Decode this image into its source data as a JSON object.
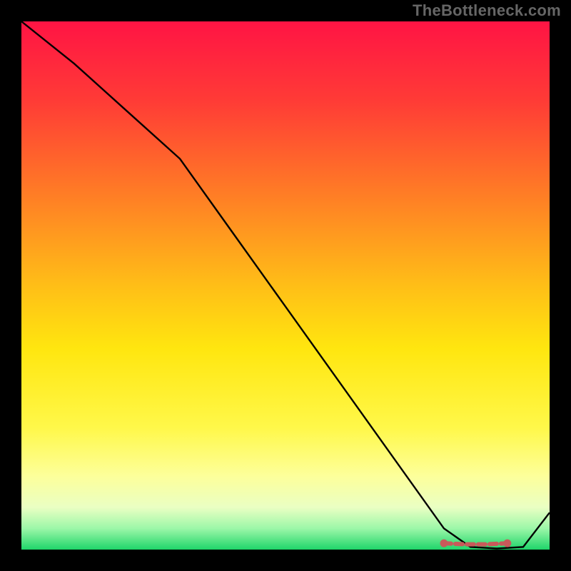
{
  "watermark": "TheBottleneck.com",
  "chart_data": {
    "type": "line",
    "title": "",
    "xlabel": "",
    "ylabel": "",
    "xlim": [
      0,
      100
    ],
    "ylim": [
      0,
      100
    ],
    "grid": false,
    "legend": false,
    "gradient_stops": [
      {
        "offset": 0,
        "color": "#ff1444"
      },
      {
        "offset": 0.15,
        "color": "#ff3b36"
      },
      {
        "offset": 0.32,
        "color": "#ff7a26"
      },
      {
        "offset": 0.5,
        "color": "#ffbe17"
      },
      {
        "offset": 0.62,
        "color": "#ffe60f"
      },
      {
        "offset": 0.77,
        "color": "#fff84a"
      },
      {
        "offset": 0.86,
        "color": "#fdff9a"
      },
      {
        "offset": 0.92,
        "color": "#eaffc3"
      },
      {
        "offset": 0.96,
        "color": "#9cf7a8"
      },
      {
        "offset": 1.0,
        "color": "#1fd56a"
      }
    ],
    "series": [
      {
        "name": "curve",
        "color": "#000000",
        "x": [
          0,
          10,
          20,
          30,
          40,
          50,
          60,
          70,
          80,
          85,
          90,
          95,
          100
        ],
        "y": [
          100,
          92,
          83,
          74,
          60,
          46,
          32,
          18,
          4,
          0.5,
          0.2,
          0.5,
          7
        ]
      }
    ],
    "markers": {
      "name": "annotated-region",
      "color": "#c85a5a",
      "style": "dash",
      "x": [
        80,
        82,
        84,
        86,
        88,
        90,
        92
      ],
      "y": [
        1.2,
        1.1,
        1.0,
        1.0,
        1.0,
        1.1,
        1.2
      ]
    }
  }
}
